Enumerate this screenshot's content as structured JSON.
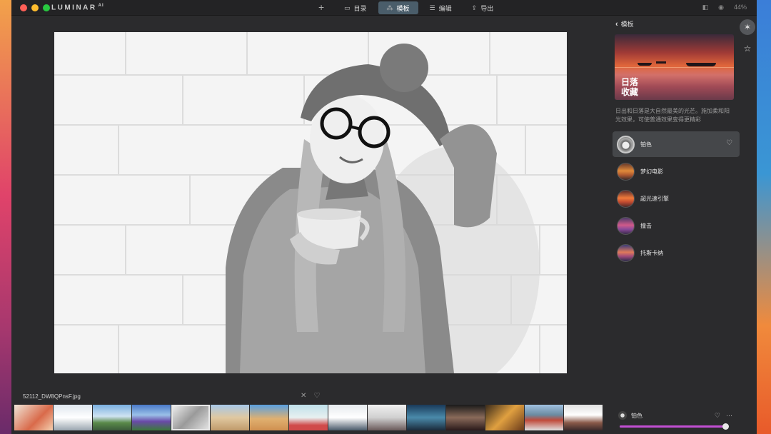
{
  "app": {
    "brand": "LUMINAR",
    "brand_suffix": "AI"
  },
  "toolbar": {
    "add_icon": "plus-icon",
    "tabs": [
      {
        "label": "目录",
        "icon": "folder-icon"
      },
      {
        "label": "模板",
        "icon": "magic-wand-icon",
        "active": true
      },
      {
        "label": "编辑",
        "icon": "sliders-icon"
      },
      {
        "label": "导出",
        "icon": "share-icon"
      }
    ],
    "zoom": "44%"
  },
  "panel": {
    "back_label": "模板",
    "hero_title_line1": "日落",
    "hero_title_line2": "收藏",
    "description": "日出和日落是大自然最美的光芒。施加柔和阳光效果，可使普通效果变得更精彩",
    "presets": [
      {
        "label": "铂色",
        "selected": true
      },
      {
        "label": "梦幻电影"
      },
      {
        "label": "超光速引擎"
      },
      {
        "label": "撞击"
      },
      {
        "label": "托斯卡纳"
      }
    ]
  },
  "filmstrip": {
    "filename": "52112_DW8QPnsF.jpg",
    "active_index": 4,
    "count": 15
  },
  "bottom": {
    "preset_label": "铂色",
    "amount": 0.98,
    "accent": "#c24fd3"
  }
}
